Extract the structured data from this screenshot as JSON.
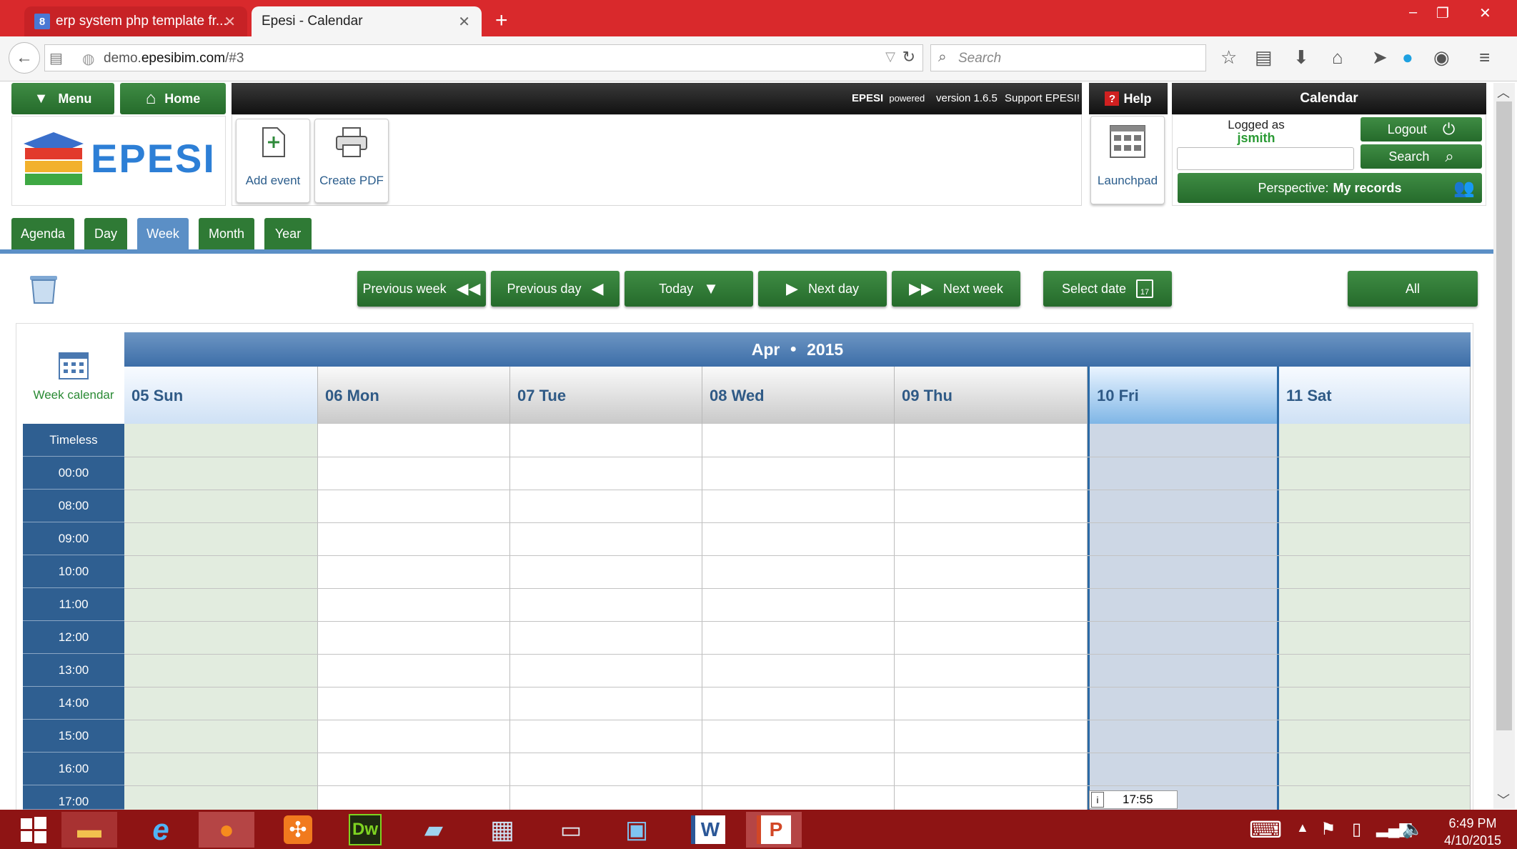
{
  "browser": {
    "tabs": [
      {
        "title": "erp system php template fr...",
        "favicon": "8"
      },
      {
        "title": "Epesi - Calendar"
      }
    ],
    "url_prefix": "demo.",
    "url_domain": "epesibim.com",
    "url_suffix": "/#3",
    "search_placeholder": "Search"
  },
  "header": {
    "menu_label": "Menu",
    "home_label": "Home",
    "logo_text": "EPESI",
    "status_brand": "EPESI",
    "status_powered": "powered",
    "status_version": "version 1.6.5",
    "status_support": "Support EPESI!",
    "help_label": "Help",
    "launchpad_label": "Launchpad",
    "module_title": "Calendar",
    "logged_as_label": "Logged as",
    "username": "jsmith",
    "logout_label": "Logout",
    "search_label": "Search",
    "perspective_label": "Perspective:",
    "perspective_value": "My records"
  },
  "toolbar": {
    "add_event_label": "Add event",
    "create_pdf_label": "Create PDF"
  },
  "view_tabs": [
    "Agenda",
    "Day",
    "Week",
    "Month",
    "Year"
  ],
  "active_view": "Week",
  "navigation": {
    "previous_week": "Previous week",
    "previous_day": "Previous day",
    "today": "Today",
    "next_day": "Next day",
    "next_week": "Next week",
    "select_date": "Select date",
    "select_date_icon_num": "17",
    "all": "All"
  },
  "calendar": {
    "month": "Apr",
    "year": "2015",
    "week_calendar_label": "Week calendar",
    "days": [
      "05 Sun",
      "06 Mon",
      "07 Tue",
      "08 Wed",
      "09 Thu",
      "10 Fri",
      "11 Sat"
    ],
    "today_index": 5,
    "times": [
      "Timeless",
      "00:00",
      "08:00",
      "09:00",
      "10:00",
      "11:00",
      "12:00",
      "13:00",
      "14:00",
      "15:00",
      "16:00",
      "17:00"
    ],
    "current_time": "17:55"
  },
  "taskbar": {
    "time": "6:49 PM",
    "date": "4/10/2015"
  },
  "colors": {
    "browser_red": "#d9292c",
    "epesi_green": "#2f7a35",
    "epesi_blue": "#2f5f91",
    "today_column": "#cdd7e5",
    "weekend_column": "#e2ecdf",
    "taskbar": "#8e1414"
  }
}
